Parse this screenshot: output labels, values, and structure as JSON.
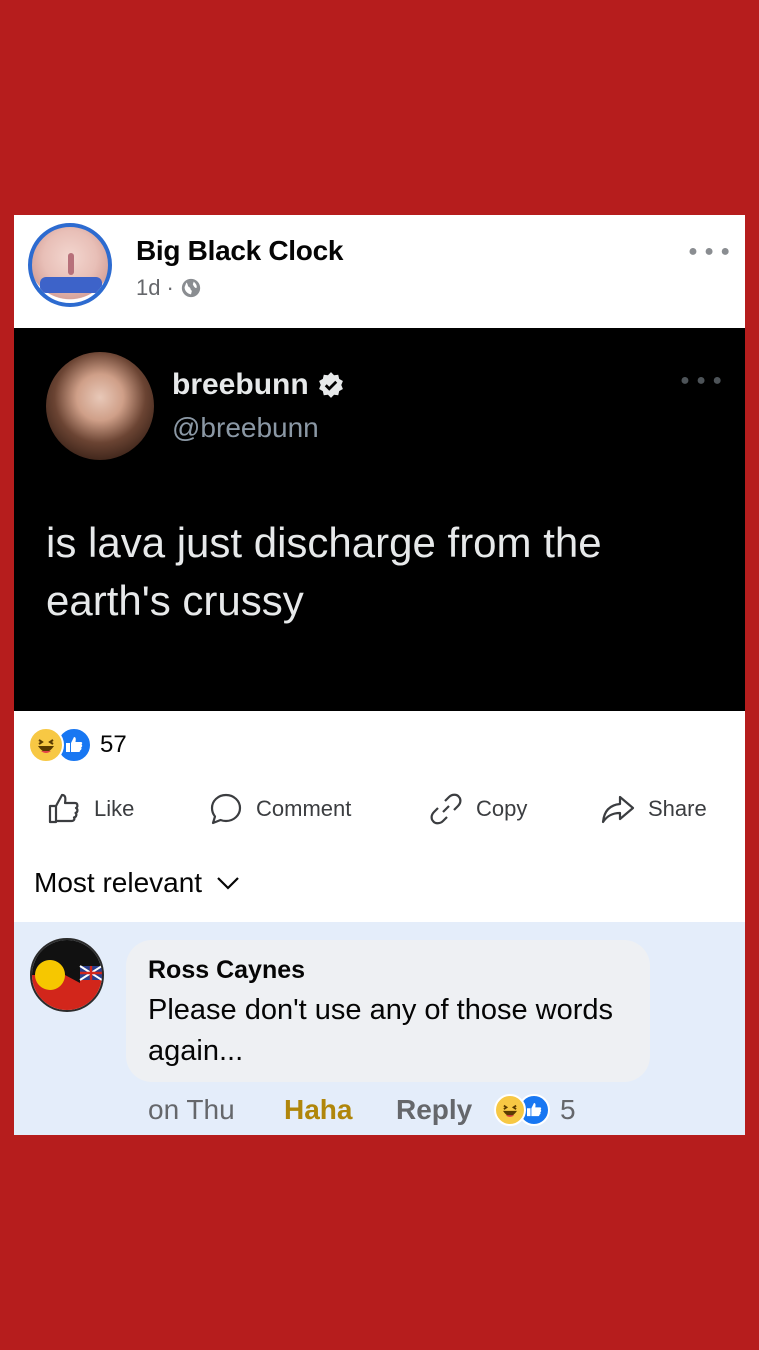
{
  "post": {
    "page_name": "Big Black Clock",
    "time": "1d",
    "separator": "·"
  },
  "tweet": {
    "display_name": "breebunn",
    "handle": "@breebunn",
    "text": "is lava just discharge from the earth's crussy"
  },
  "reactions": {
    "count": "57",
    "icons": [
      "haha-emoji",
      "like-emoji"
    ]
  },
  "actions": {
    "like": "Like",
    "comment": "Comment",
    "copy": "Copy",
    "share": "Share"
  },
  "comments": {
    "sort_label": "Most relevant",
    "items": [
      {
        "author": "Ross Caynes",
        "text": "Please don't use any of those words again...",
        "time": "on Thu",
        "reaction_label": "Haha",
        "reply_label": "Reply",
        "reaction_count": "5"
      }
    ]
  },
  "colors": {
    "background": "#b61d1d",
    "accent": "#1877f2",
    "haha": "#f7c844"
  }
}
